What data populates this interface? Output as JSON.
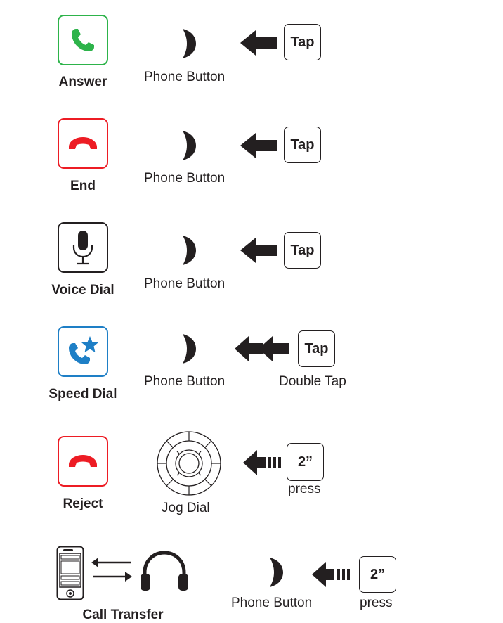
{
  "rows": [
    {
      "label": "Answer",
      "button_name": "Phone Button",
      "action": "Tap"
    },
    {
      "label": "End",
      "button_name": "Phone Button",
      "action": "Tap"
    },
    {
      "label": "Voice Dial",
      "button_name": "Phone Button",
      "action": "Tap"
    },
    {
      "label": "Speed Dial",
      "button_name": "Phone Button",
      "action": "Tap",
      "action_note": "Double Tap"
    },
    {
      "label": "Reject",
      "button_name": "Jog Dial",
      "action": "2”",
      "action_note": "press"
    },
    {
      "label": "Call Transfer",
      "button_name": "Phone Button",
      "action": "2”",
      "action_note": "press"
    }
  ],
  "colors": {
    "answer": "#2db34a",
    "end": "#ed1c24",
    "speed_dial": "#1e7fc6",
    "ink": "#231f20"
  },
  "icons": [
    "phone-icon",
    "hangup-icon",
    "microphone-icon",
    "speed-dial-icon",
    "hangup-icon",
    "smartphone-icon",
    "transfer-arrows-icon",
    "headphones-icon",
    "phone-button-icon",
    "jog-dial-icon",
    "arrow-left-icon",
    "double-arrow-left-icon",
    "long-press-arrow-icon"
  ]
}
